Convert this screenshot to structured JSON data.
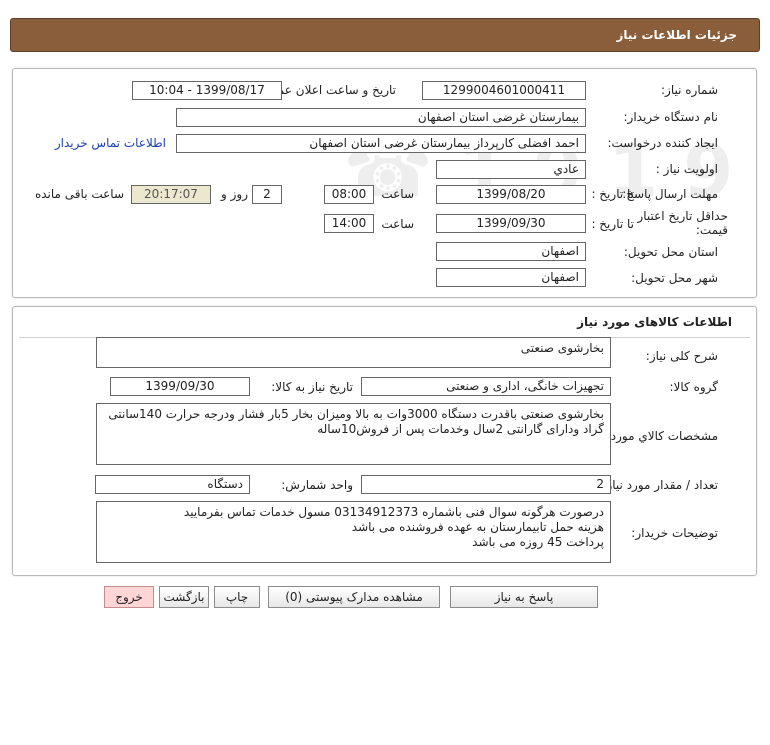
{
  "header": {
    "title": "جزئیات اطلاعات نیاز"
  },
  "need": {
    "number_label": "شماره نیاز:",
    "number_value": "1299004601000411",
    "announce_label": "تاریخ و ساعت اعلان عمومی:",
    "announce_value": "1399/08/17 - 10:04",
    "buyer_label": "نام دستگاه خریدار:",
    "buyer_value": "بیمارستان غرضی استان اصفهان",
    "creator_label": "ایجاد کننده درخواست:",
    "creator_value": "احمد افضلی کارپرداز بیمارستان غرضی استان اصفهان",
    "contact_link": "اطلاعات تماس خریدار",
    "priority_label": "اولویت نیاز :",
    "priority_value": "عادي",
    "deadline_label": "مهلت ارسال پاسخ:",
    "to_date_label": "تا تاریخ :",
    "deadline_date": "1399/08/20",
    "time_label": "ساعت",
    "deadline_time": "08:00",
    "days_value": "2",
    "days_label": "روز و",
    "remaining_time": "20:17:07",
    "remaining_label": "ساعت باقی مانده",
    "validity_label": "حداقل تاریخ اعتبار قیمت:",
    "validity_date": "1399/09/30",
    "validity_time": "14:00",
    "province_label": "استان محل تحویل:",
    "province_value": "اصفهان",
    "city_label": "شهر محل تحویل:",
    "city_value": "اصفهان"
  },
  "goods": {
    "section_title": "اطلاعات کالاهای مورد نیاز",
    "summary_label": "شرح کلی نیاز:",
    "summary_value": "بخارشوی صنعتی",
    "group_label": "گروه کالا:",
    "group_value": "تجهیزات خانگی، اداری و صنعتی",
    "need_date_label": "تاریخ نیاز به کالا:",
    "need_date_value": "1399/09/30",
    "specs_label": "مشخصات کالاي مورد نياز:",
    "specs_value": "بخارشوی صنعتی باقدرت دستگاه 3000وات به بالا ومیزان بخار 5بار فشار ودرجه حرارت 140سانتی گراد ودارای گارانتی 2سال وخدمات پس از فروش10ساله",
    "qty_label": "تعداد / مقدار مورد نیاز:",
    "qty_value": "2",
    "unit_label": "واحد شمارش:",
    "unit_value": "دستگاه",
    "notes_label": "توضیحات خریدار:",
    "notes_line1": "درصورت هرگونه سوال فنی باشماره 03134912373 مسول خدمات تماس بفرمایید",
    "notes_line2": "هزینه حمل تابیمارستان به عهده فروشنده می باشد",
    "notes_line3": "پرداخت 45 روزه می باشد"
  },
  "buttons": {
    "reply": "پاسخ به نیاز",
    "attachments": "مشاهده مدارک پیوستی (0)",
    "print": "چاپ",
    "back": "بازگشت",
    "exit": "خروج"
  }
}
